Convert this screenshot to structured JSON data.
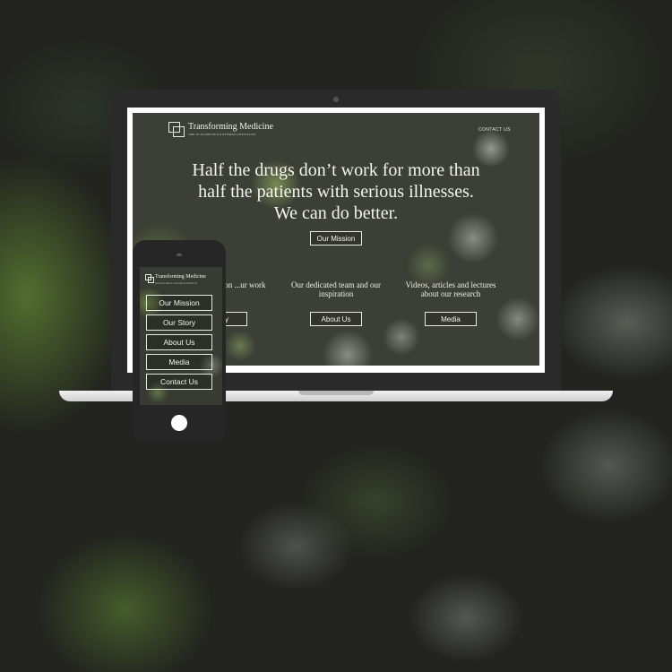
{
  "site": {
    "logo_name": "Transforming Medicine",
    "logo_sub": "THE ELIZABETH KAUFFMAN INSTITUTE",
    "contact_link": "CONTACT US",
    "headline": "Half the drugs don’t work for more than half the patients with serious illnesses. We can do better.",
    "mission_button": "Our Mission",
    "columns": [
      {
        "text": "...n and passion ...ur work",
        "button": "...tory"
      },
      {
        "text": "Our dedicated team and our inspiration",
        "button": "About Us"
      },
      {
        "text": "Videos, articles and lectures about our research",
        "button": "Media"
      }
    ]
  },
  "phone": {
    "logo_name": "Transforming Medicine",
    "logo_sub": "THE ELIZABETH KAUFFMAN INSTITUTE",
    "menu": [
      "Our Mission",
      "Our Story",
      "About Us",
      "Media",
      "Contact Us"
    ]
  }
}
